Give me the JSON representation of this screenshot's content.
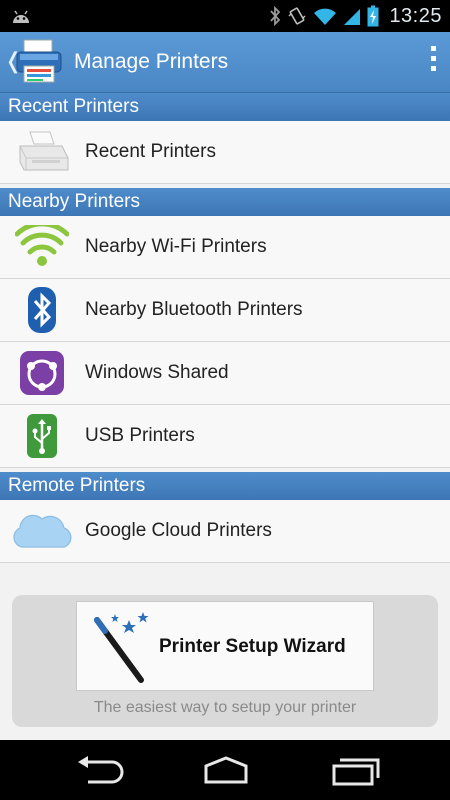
{
  "status_bar": {
    "time": "13:25",
    "icons": [
      "android-icon",
      "bluetooth-icon",
      "vibrate-icon",
      "wifi-icon",
      "signal-icon",
      "battery-icon"
    ]
  },
  "action_bar": {
    "title": "Manage Printers",
    "back_glyph": "❬",
    "icons": [
      "app-printer-icon",
      "overflow-menu-icon"
    ]
  },
  "sections": {
    "recent": {
      "header": "Recent Printers",
      "items": [
        {
          "label": "Recent Printers",
          "icon": "printer-icon"
        }
      ]
    },
    "nearby": {
      "header": "Nearby Printers",
      "items": [
        {
          "label": "Nearby Wi-Fi Printers",
          "icon": "wifi-icon"
        },
        {
          "label": "Nearby Bluetooth Printers",
          "icon": "bluetooth-icon"
        },
        {
          "label": "Windows Shared",
          "icon": "windows-shared-icon"
        },
        {
          "label": "USB Printers",
          "icon": "usb-icon"
        }
      ]
    },
    "remote": {
      "header": "Remote Printers",
      "items": [
        {
          "label": "Google Cloud Printers",
          "icon": "cloud-icon"
        }
      ]
    }
  },
  "wizard": {
    "button_label": "Printer Setup Wizard",
    "subtitle": "The easiest way to setup your printer",
    "icon": "magic-wand-icon"
  },
  "nav_bar": {
    "icons": [
      "back-icon",
      "home-icon",
      "recent-apps-icon"
    ]
  },
  "colors": {
    "accent": "#4a86c4",
    "section_header": "#3d76b5",
    "wifi_green": "#8cc63f",
    "bluetooth_blue": "#1f5fb0",
    "windows_purple": "#7b3fa6",
    "usb_green": "#3e9a3a"
  }
}
